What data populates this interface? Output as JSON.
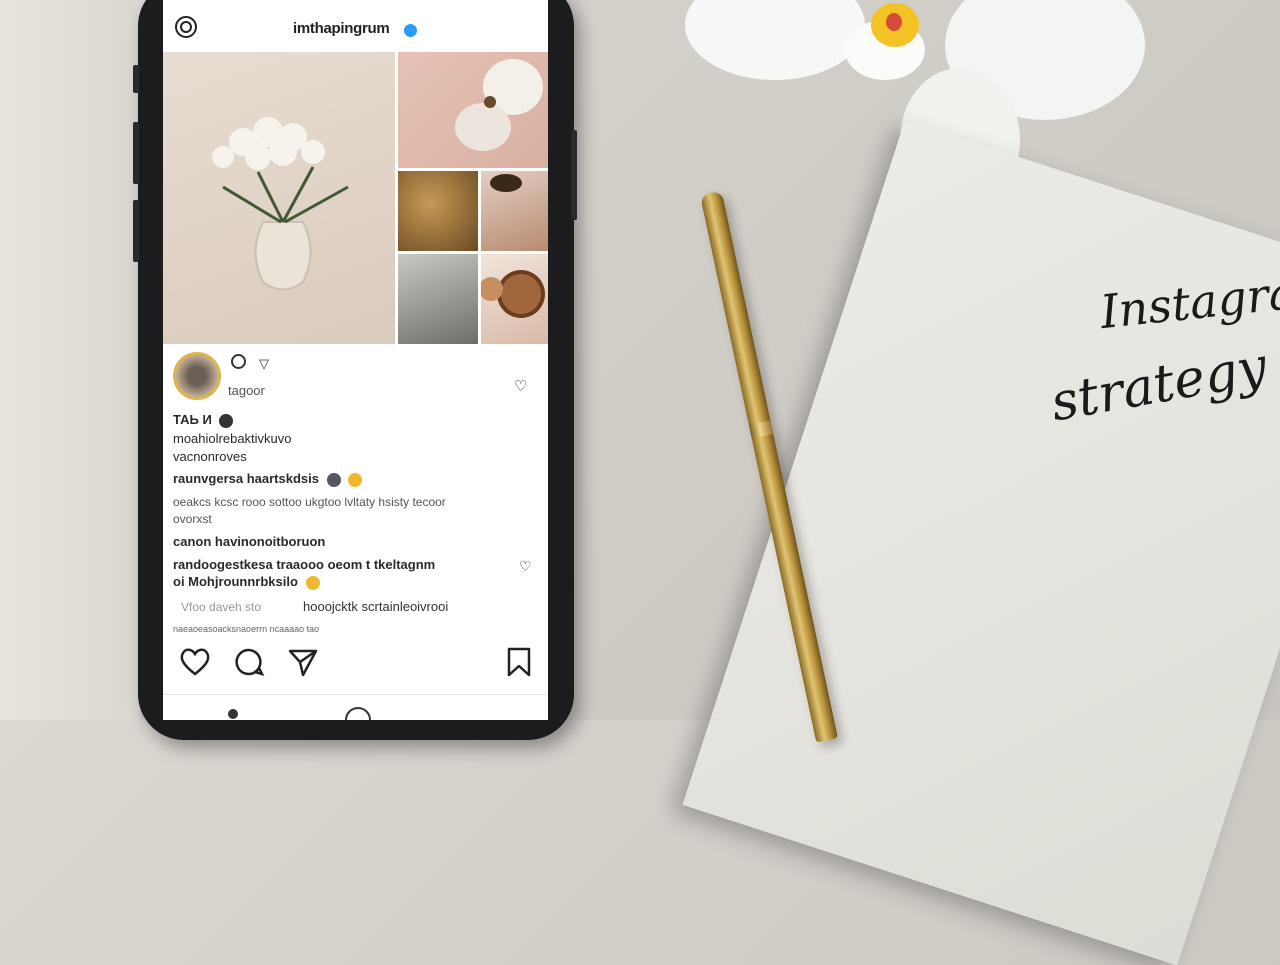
{
  "profile": {
    "username": "imthapingrum"
  },
  "post": {
    "account_label": "tagoor",
    "lines": [
      "ТАЬ И",
      "moahiolrebaktivkuvo",
      "vacnonroves",
      "raunvgersa haartskdsis",
      "oeakcs kcsc rooo sottoo ukgtoo lvltaty hsisty tecoor",
      "ovorxst",
      "canon havinonoitboruon",
      "randoogestkesa traaooo oeom t tkeltagnm",
      "oi Mohjrounnrbksilo",
      "Vfoo daveh sto",
      "hooojcktk scrtainleoivrooi",
      "naeaoeasoacksnaoerrn ncaaaao tao"
    ]
  },
  "actions": {
    "like": "heart-icon",
    "comment": "comment-icon",
    "share": "share-icon",
    "save": "bookmark-icon"
  },
  "card": {
    "line1": "Instagra",
    "line2": "strategy"
  },
  "colors": {
    "verified": "#2b9af3",
    "story_ring": "#e0b34a",
    "pen_gold": "#c9a24e"
  }
}
